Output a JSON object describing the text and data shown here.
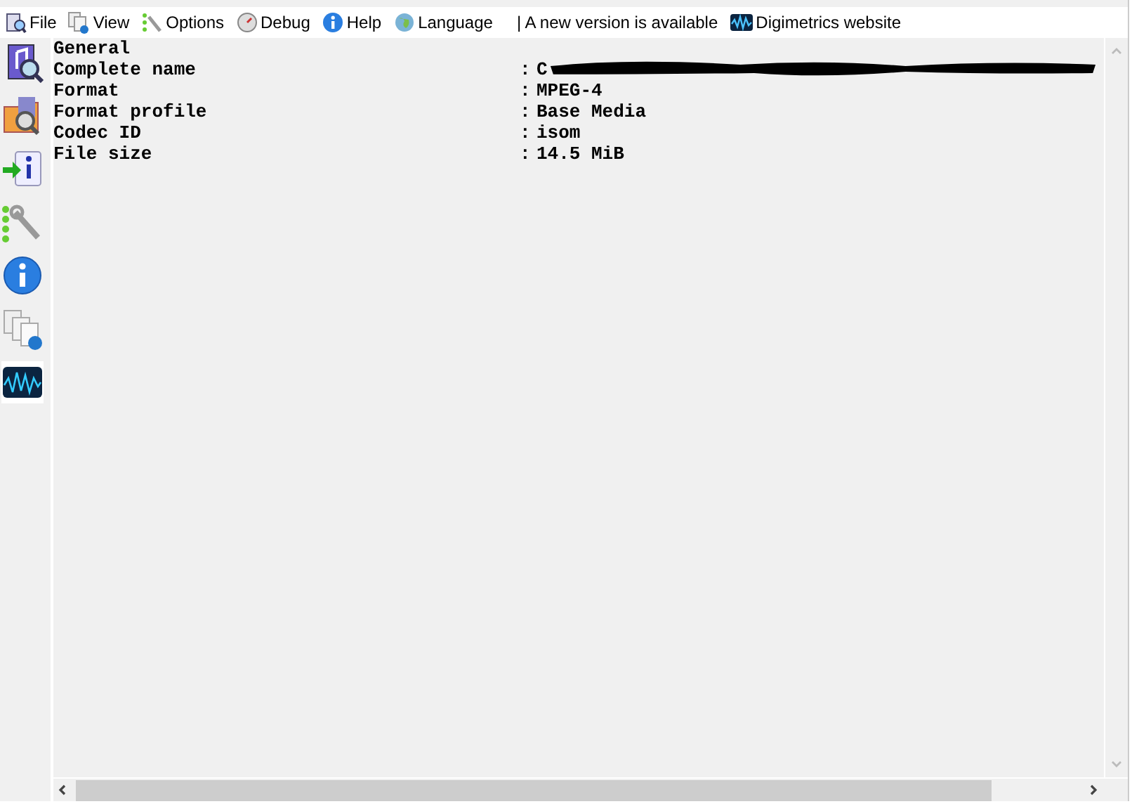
{
  "menu": [
    {
      "label": "File"
    },
    {
      "label": "View"
    },
    {
      "label": "Options"
    },
    {
      "label": "Debug"
    },
    {
      "label": "Help"
    },
    {
      "label": "Language"
    }
  ],
  "notices": [
    {
      "kind": "text",
      "label": "| A new version is available"
    },
    {
      "kind": "link",
      "label": "Digimetrics website"
    }
  ],
  "report": {
    "section": "General",
    "fields": [
      {
        "label": "Complete name",
        "separator": ":",
        "value": "C",
        "redacted": true
      },
      {
        "label": "Format",
        "separator": ":",
        "value": "MPEG-4",
        "redacted": false
      },
      {
        "label": "Format profile",
        "separator": ":",
        "value": "Base Media",
        "redacted": false
      },
      {
        "label": "Codec ID",
        "separator": ":",
        "value": "isom",
        "redacted": false
      },
      {
        "label": "File size",
        "separator": ":",
        "value": "14.5 MiB",
        "redacted": false
      }
    ]
  }
}
